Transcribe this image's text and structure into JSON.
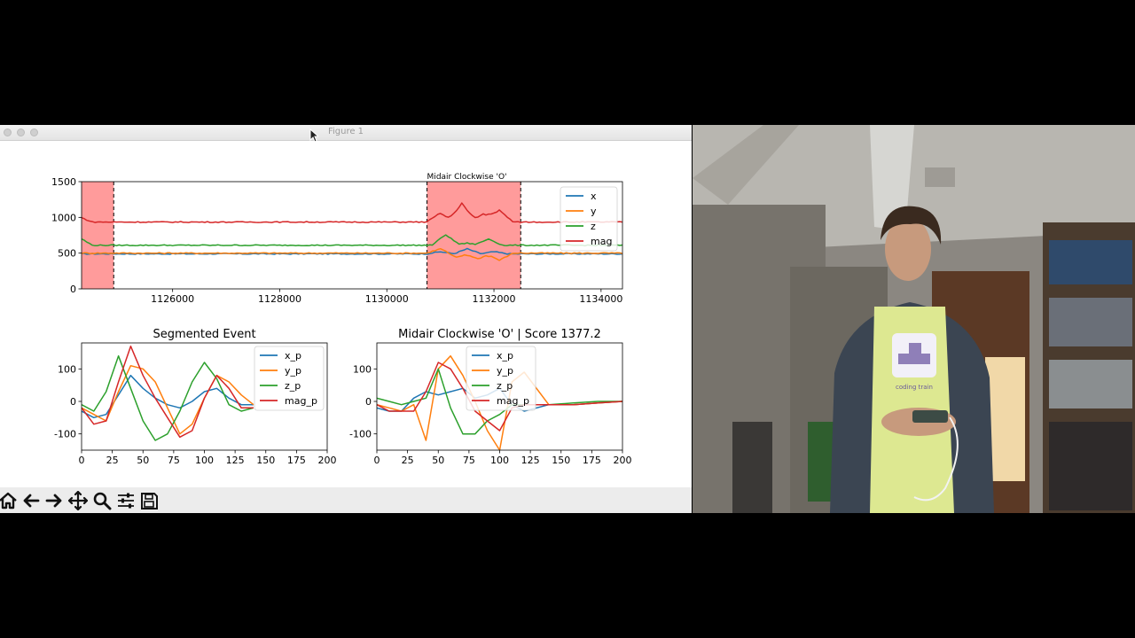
{
  "window": {
    "title": "Figure 1"
  },
  "colors": {
    "x": "#1f77b4",
    "y": "#ff7f0e",
    "z": "#2ca02c",
    "mag": "#d62728",
    "highlight": "#ff9b9b"
  },
  "toolbar": {
    "icons": [
      "home-icon",
      "back-icon",
      "forward-icon",
      "pan-icon",
      "zoom-icon",
      "configure-icon",
      "save-icon"
    ]
  },
  "video": {
    "shirt_text": "coding train"
  },
  "chart_data": [
    {
      "type": "line",
      "title": "",
      "annotation": "Midair Clockwise 'O'",
      "xlim": [
        1124300,
        1134400
      ],
      "ylim": [
        0,
        1500
      ],
      "xticks": [
        1126000,
        1128000,
        1130000,
        1132000,
        1134000
      ],
      "yticks": [
        0,
        500,
        1000,
        1500
      ],
      "highlight_regions": [
        [
          1124300,
          1124900
        ],
        [
          1130750,
          1132500
        ]
      ],
      "legend": "top-right",
      "series": [
        {
          "name": "x",
          "baseline": 490,
          "event": [
            [
              1131000,
              520
            ],
            [
              1131500,
              560
            ],
            [
              1132000,
              520
            ]
          ]
        },
        {
          "name": "y",
          "baseline": 500,
          "event": [
            [
              1131000,
              560
            ],
            [
              1131300,
              440
            ],
            [
              1131700,
              420
            ],
            [
              1132100,
              400
            ]
          ]
        },
        {
          "name": "z",
          "baseline": 610,
          "event": [
            [
              1131100,
              760
            ],
            [
              1131500,
              640
            ],
            [
              1131900,
              700
            ],
            [
              1132300,
              610
            ]
          ]
        },
        {
          "name": "mag",
          "baseline": 935,
          "event": [
            [
              1131000,
              1060
            ],
            [
              1131400,
              1200
            ],
            [
              1131800,
              1050
            ],
            [
              1132100,
              1100
            ]
          ]
        }
      ]
    },
    {
      "type": "line",
      "title": "Segmented Event",
      "xlim": [
        0,
        200
      ],
      "ylim": [
        -150,
        180
      ],
      "xticks": [
        0,
        25,
        50,
        75,
        100,
        125,
        150,
        175,
        200
      ],
      "yticks": [
        -100,
        0,
        100
      ],
      "legend": "top-right",
      "x": [
        0,
        10,
        20,
        30,
        40,
        50,
        60,
        70,
        80,
        90,
        100,
        110,
        120,
        130,
        140
      ],
      "series": [
        {
          "name": "x_p",
          "values": [
            -30,
            -50,
            -40,
            20,
            80,
            40,
            10,
            -10,
            -20,
            0,
            30,
            40,
            10,
            -10,
            -10
          ]
        },
        {
          "name": "y_p",
          "values": [
            -20,
            -40,
            -60,
            30,
            110,
            100,
            60,
            -20,
            -100,
            -70,
            10,
            80,
            60,
            20,
            -10
          ]
        },
        {
          "name": "z_p",
          "values": [
            -10,
            -30,
            30,
            140,
            40,
            -60,
            -120,
            -100,
            -30,
            60,
            120,
            70,
            -10,
            -30,
            -20
          ]
        },
        {
          "name": "mag_p",
          "values": [
            -20,
            -70,
            -60,
            60,
            170,
            80,
            10,
            -50,
            -110,
            -90,
            10,
            80,
            40,
            -20,
            -20
          ]
        }
      ]
    },
    {
      "type": "line",
      "title": "Midair Clockwise 'O' | Score 1377.2",
      "xlim": [
        0,
        200
      ],
      "ylim": [
        -150,
        180
      ],
      "xticks": [
        0,
        25,
        50,
        75,
        100,
        125,
        150,
        175,
        200
      ],
      "yticks": [
        -100,
        0,
        100
      ],
      "legend": "top-center",
      "x": [
        0,
        10,
        20,
        30,
        40,
        50,
        60,
        70,
        80,
        90,
        100,
        110,
        120,
        140,
        160,
        180,
        200
      ],
      "series": [
        {
          "name": "x_p",
          "values": [
            -20,
            -30,
            -30,
            10,
            30,
            20,
            30,
            40,
            10,
            20,
            40,
            -10,
            -30,
            -10,
            -10,
            -5,
            0
          ]
        },
        {
          "name": "y_p",
          "values": [
            -10,
            -20,
            -30,
            -10,
            -120,
            100,
            140,
            80,
            0,
            -90,
            -150,
            60,
            90,
            -10,
            -10,
            -5,
            0
          ]
        },
        {
          "name": "z_p",
          "values": [
            10,
            0,
            -10,
            0,
            10,
            100,
            -20,
            -100,
            -100,
            -60,
            -40,
            -10,
            -10,
            -10,
            -5,
            0,
            0
          ]
        },
        {
          "name": "mag_p",
          "values": [
            -10,
            -30,
            -30,
            -30,
            30,
            120,
            100,
            40,
            -30,
            -60,
            -90,
            -20,
            -10,
            -10,
            -10,
            -5,
            0
          ]
        }
      ]
    }
  ]
}
